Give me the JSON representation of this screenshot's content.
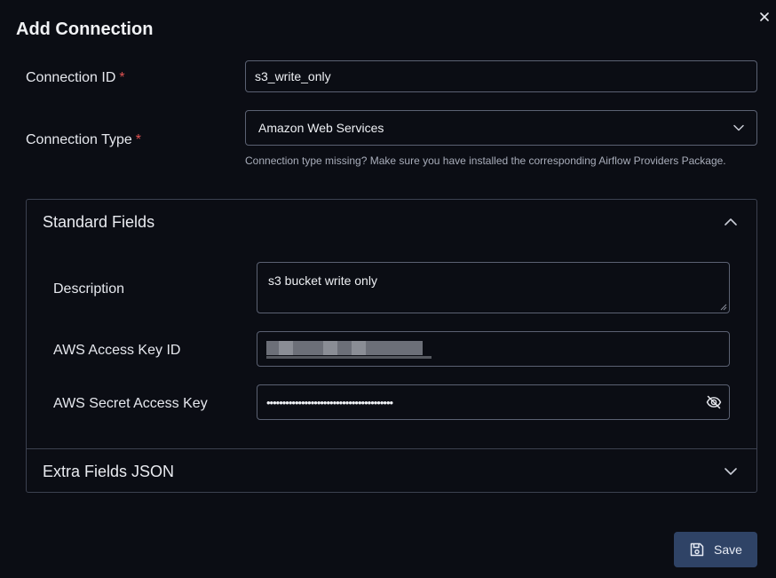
{
  "dialog": {
    "title": "Add Connection",
    "close_icon": "close-icon"
  },
  "connection_id": {
    "label": "Connection ID",
    "required_mark": "*",
    "value": "s3_write_only"
  },
  "connection_type": {
    "label": "Connection Type",
    "required_mark": "*",
    "selected": "Amazon Web Services",
    "helper": "Connection type missing? Make sure you have installed the corresponding Airflow Providers Package."
  },
  "standard_fields": {
    "header": "Standard Fields",
    "expanded": true,
    "description": {
      "label": "Description",
      "value": "s3 bucket write only"
    },
    "aws_access_key_id": {
      "label": "AWS Access Key ID",
      "value_redacted": true
    },
    "aws_secret_access_key": {
      "label": "AWS Secret Access Key",
      "value": "••••••••••••••••••••••••••••••••••••••••",
      "toggle_icon": "eye-off-icon"
    }
  },
  "extra_fields": {
    "header": "Extra Fields JSON",
    "expanded": false
  },
  "footer": {
    "save_label": "Save",
    "save_icon": "floppy-disk-icon"
  },
  "colors": {
    "background": "#0b0d14",
    "required": "#e05252",
    "save_button": "#2f4366",
    "border": "#5b6172"
  }
}
